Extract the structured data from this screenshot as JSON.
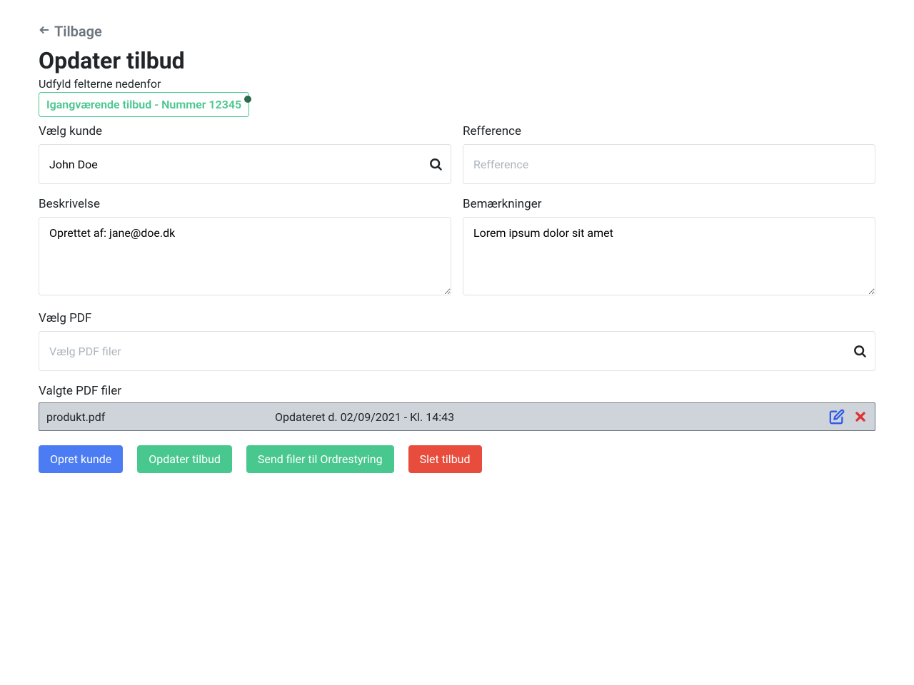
{
  "back_label": "Tilbage",
  "title": "Opdater tilbud",
  "subtitle": "Udfyld felterne nedenfor",
  "status_badge": "Igangværende tilbud - Nummer 12345",
  "customer": {
    "label": "Vælg kunde",
    "value": "John Doe"
  },
  "reference": {
    "label": "Refference",
    "placeholder": "Refference",
    "value": ""
  },
  "description": {
    "label": "Beskrivelse",
    "value": "Oprettet af: jane@doe.dk"
  },
  "remarks": {
    "label": "Bemærkninger",
    "value": "Lorem ipsum dolor sit amet"
  },
  "pdf_picker": {
    "label": "Vælg PDF",
    "placeholder": "Vælg PDF filer",
    "value": ""
  },
  "selected_pdf": {
    "label": "Valgte PDF filer",
    "file_name": "produkt.pdf",
    "updated": "Opdateret d. 02/09/2021 - Kl. 14:43"
  },
  "buttons": {
    "create_customer": "Opret kunde",
    "update_offer": "Opdater tilbud",
    "send_files": "Send filer til Ordrestyring",
    "delete_offer": "Slet tilbud"
  }
}
